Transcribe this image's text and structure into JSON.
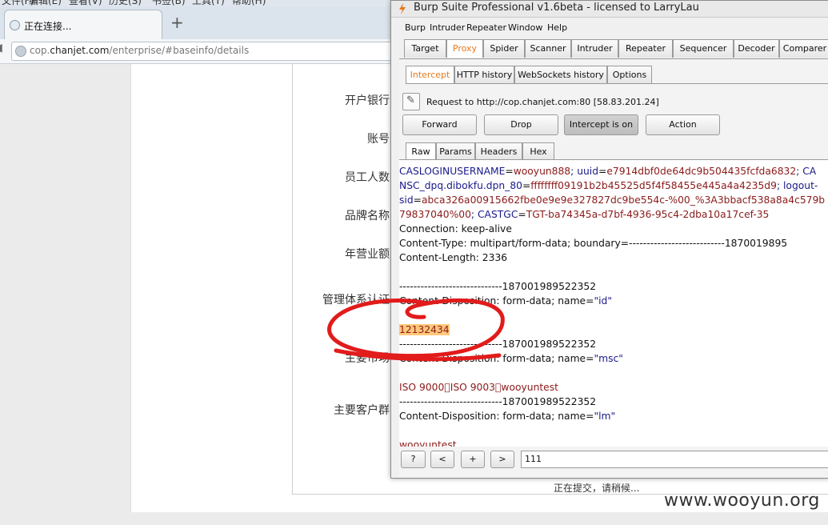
{
  "browser": {
    "menu": [
      "文件(F)",
      "编辑(E)",
      "查看(V)",
      "历史(S)",
      "书签(B)",
      "工具(T)",
      "帮助(H)"
    ],
    "tab_title": "正在连接...",
    "new_tab": "+",
    "url_prefix": "cop.",
    "url_domain": "chanjet.com",
    "url_path": "/enterprise/#baseinfo/details"
  },
  "form": {
    "labels": [
      "开户银行",
      "账号",
      "员工人数",
      "品牌名称",
      "年营业额",
      "管理体系认证",
      "主要市场",
      "主要客户群"
    ],
    "status": "正在提交，请稍候..."
  },
  "watermark": "www.wooyun.org",
  "burp": {
    "title": "Burp Suite Professional v1.6beta - licensed to LarryLau",
    "menu": [
      "Burp",
      "Intruder",
      "Repeater",
      "Window",
      "Help"
    ],
    "main_tabs": [
      "Target",
      "Proxy",
      "Spider",
      "Scanner",
      "Intruder",
      "Repeater",
      "Sequencer",
      "Decoder",
      "Comparer"
    ],
    "active_main_tab": "Proxy",
    "sub_tabs": [
      "Intercept",
      "HTTP history",
      "WebSockets history",
      "Options"
    ],
    "request_info": "Request to http://cop.chanjet.com:80  [58.83.201.24]",
    "buttons": {
      "forward": "Forward",
      "drop": "Drop",
      "intercept": "Intercept is on",
      "action": "Action"
    },
    "view_tabs": [
      "Raw",
      "Params",
      "Headers",
      "Hex"
    ],
    "lines": {
      "l1_k1": "CASLOGINUSERNAME",
      "l1_v1": "wooyun888",
      "l1_k2": "; uuid",
      "l1_v2": "e7914dbf0de64dc9b504435fcfda6832",
      "l1_k3": "; CA",
      "l2_k1": "NSC_dpq.dibokfu.dpn_80",
      "l2_v1": "ffffffff09191b2b45525d5f4f58455e445a4a4235d9",
      "l2_k2": "; logout-",
      "l3_k1": "sid",
      "l3_v1": "abca326a00915662fbe0e9e9e327827dc9be554c-%00_%3A3bbacf538a8a4c579b",
      "l4_v1": "79837040%00",
      "l4_k1": "; CASTGC",
      "l4_v2": "TGT-ba74345a-d7bf-4936-95c4-2dba10a17cef-35",
      "connection": "Connection: keep-alive",
      "content_type": "Content-Type: multipart/form-data; boundary=---------------------------1870019895",
      "content_length": "Content-Length: 2336",
      "boundary1": "-----------------------------187001989522352",
      "disp1_prefix": "Content-Disposition: form-data; name=",
      "disp1_name": "\"id\"",
      "id_value": "12132434",
      "boundary2": "-----------------------------187001989522352",
      "disp2_prefix": "Content-Disposition: form-data; name=",
      "disp2_name": "\"msc\"",
      "msc_value": "ISO 9000\u0000ISO 9003\u0000wooyuntest",
      "boundary3": "-----------------------------187001989522352",
      "disp3_prefix": "Content-Disposition: form-data; name=",
      "disp3_name": "\"lm\"",
      "lm_value": "wooyuntest"
    },
    "nav_buttons": [
      "?",
      "<",
      "+",
      ">"
    ],
    "search_value": "111"
  },
  "colors": {
    "accent": "#e8791c",
    "annotation": "#e21b1b",
    "highlight": "#ffc87a"
  }
}
